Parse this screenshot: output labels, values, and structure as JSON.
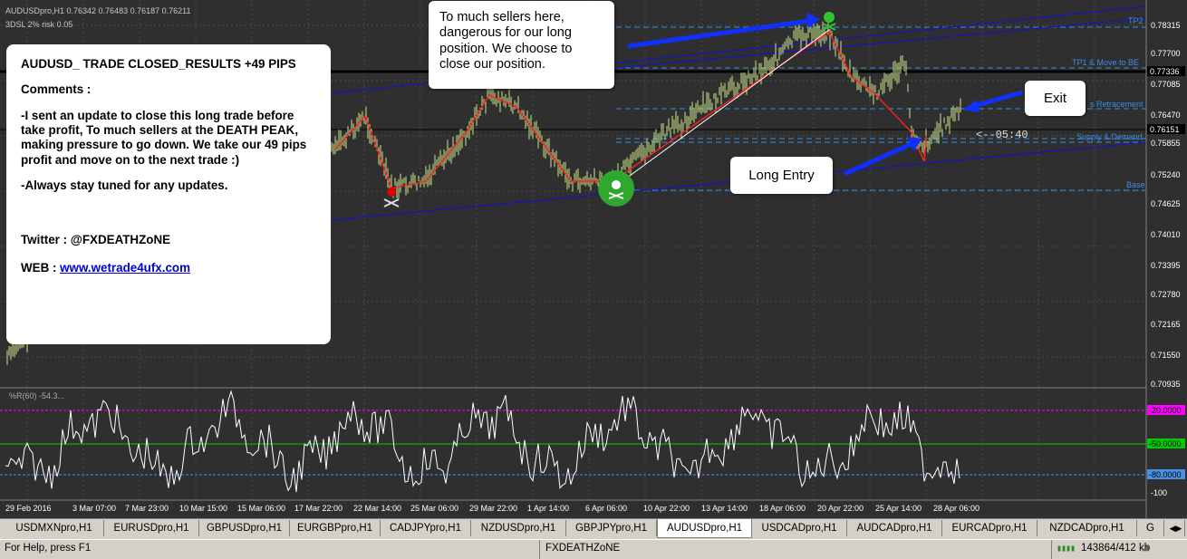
{
  "chart_header": {
    "symbol_line": "AUDUSDpro,H1  0.76342 0.76483 0.76187 0.76211",
    "ea_line": "3DSL   2% risk     0.05"
  },
  "price_axis": [
    "0.78315",
    "0.77700",
    "0.77336",
    "0.77085",
    "0.76470",
    "0.76151",
    "0.75855",
    "0.75240",
    "0.74625",
    "0.74010",
    "0.73395",
    "0.72780",
    "0.72165",
    "0.71550",
    "0.70935"
  ],
  "level_labels": {
    "tp2": "TP2",
    "tp1": "TP1 & Move to BE",
    "retracement": "s Retracement",
    "supply_demand": "Supply & Demand",
    "base": "Base"
  },
  "countdown": "<--05:40",
  "callouts": {
    "sellers": "To much sellers here, dangerous for our long position. We choose to close our position.",
    "exit": "Exit",
    "entry": "Long Entry"
  },
  "note": {
    "title": "AUDUSD_ TRADE CLOSED_RESULTS +49 PIPS",
    "comments_label": "Comments :",
    "comment1": "-I sent an update to close this long trade before take profit, To much sellers at the DEATH PEAK, making pressure to go down. We take our 49 pips profit and move on to the next trade :)",
    "comment2": "-Always stay tuned for any updates.",
    "twitter": "Twitter : @FXDEATHZoNE",
    "web_label": "WEB     : ",
    "web_link": "www.wetrade4ufx.com"
  },
  "indicator": {
    "label": "%R(60) -54.3...",
    "levels": [
      "-20.0000",
      "-50.0000",
      "-80.0000"
    ],
    "bottom_label": "-100",
    "level_colors": [
      "#ff00ff",
      "#00cc00",
      "#4a90e2"
    ]
  },
  "time_axis": [
    "29 Feb 2016",
    "3 Mar 07:00",
    "7 Mar 23:00",
    "10 Mar 15:00",
    "15 Mar 06:00",
    "17 Mar 22:00",
    "22 Mar 14:00",
    "25 Mar 06:00",
    "29 Mar 22:00",
    "1 Apr 14:00",
    "6 Apr 06:00",
    "10 Apr 22:00",
    "13 Apr 14:00",
    "18 Apr 06:00",
    "20 Apr 22:00",
    "25 Apr 14:00",
    "28 Apr 06:00"
  ],
  "tabs": [
    "USDMXNpro,H1",
    "EURUSDpro,H1",
    "GBPUSDpro,H1",
    "EURGBPpro,H1",
    "CADJPYpro,H1",
    "NZDUSDpro,H1",
    "GBPJPYpro,H1",
    "AUDUSDpro,H1",
    "USDCADpro,H1",
    "AUDCADpro,H1",
    "EURCADpro,H1",
    "NZDCADpro,H1",
    "G"
  ],
  "active_tab": "AUDUSDpro,H1",
  "status": {
    "help": "For Help, press F1",
    "profile": "FXDEATHZoNE",
    "traffic": "143864/412 kb"
  },
  "colors": {
    "chart_bg": "#2f2f2f",
    "candle_bull": "#c8e58a",
    "level_blue": "#3a8ee6",
    "channel": "#1010e0",
    "zigzag": "#ff2020",
    "arrow": "#1030ff"
  }
}
